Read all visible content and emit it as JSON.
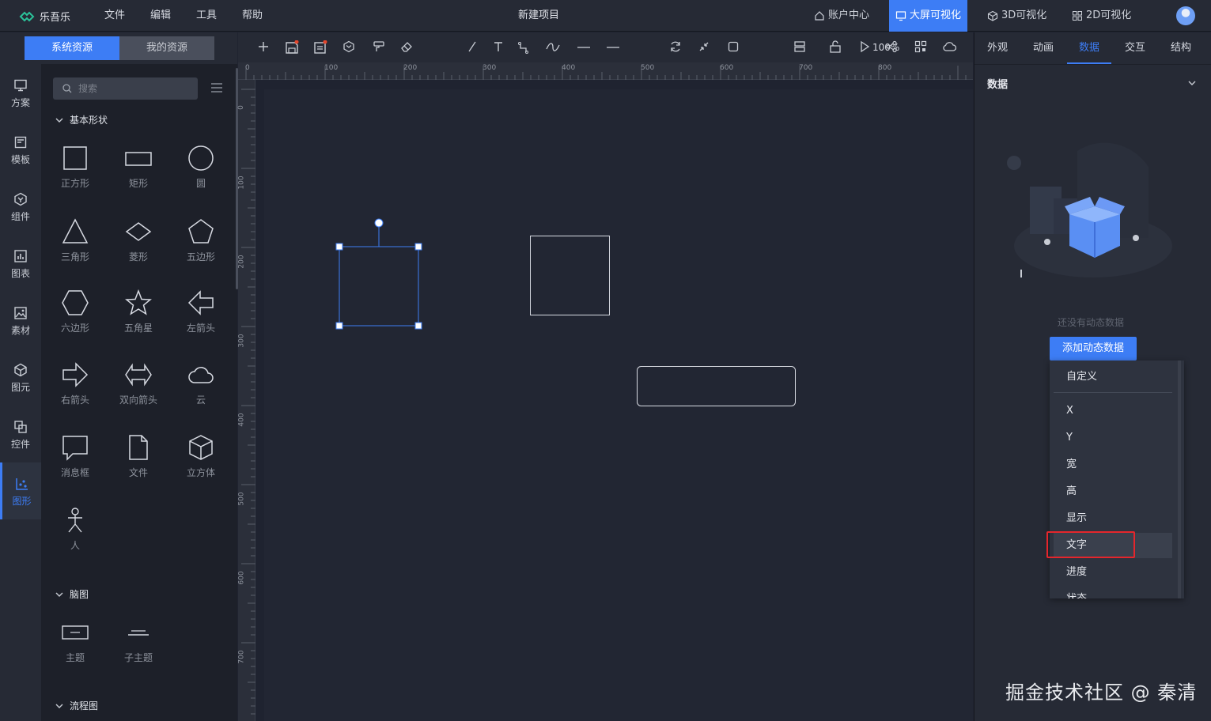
{
  "app": {
    "name": "乐吾乐",
    "project_title": "新建项目"
  },
  "menu": [
    "文件",
    "编辑",
    "工具",
    "帮助"
  ],
  "nav": {
    "account": "账户中心",
    "bigscreen": "大屏可视化",
    "viz3d": "3D可视化",
    "viz2d": "2D可视化"
  },
  "resource_tabs": {
    "system": "系统资源",
    "mine": "我的资源"
  },
  "side_nav": [
    "方案",
    "模板",
    "组件",
    "图表",
    "素材",
    "图元",
    "控件",
    "图形"
  ],
  "search": {
    "placeholder": "搜索"
  },
  "sections": {
    "basic": "基本形状",
    "mind": "脑图",
    "flow": "流程图"
  },
  "shapes": [
    "正方形",
    "矩形",
    "圆",
    "三角形",
    "菱形",
    "五边形",
    "六边形",
    "五角星",
    "左箭头",
    "右箭头",
    "双向箭头",
    "云",
    "消息框",
    "文件",
    "立方体",
    "人"
  ],
  "mind_shapes": [
    "主题",
    "子主题"
  ],
  "toolbar": {
    "zoom": "100%"
  },
  "ruler": {
    "h": [
      "0",
      "100",
      "200",
      "300",
      "400",
      "500",
      "600",
      "700",
      "800"
    ],
    "v": [
      "0",
      "100",
      "200",
      "300",
      "400",
      "500",
      "600",
      "700"
    ]
  },
  "right_tabs": [
    "外观",
    "动画",
    "数据",
    "交互",
    "结构"
  ],
  "data_panel": {
    "title": "数据",
    "empty_text": "还没有动态数据",
    "add_button": "添加动态数据",
    "dropdown": [
      "自定义",
      "X",
      "Y",
      "宽",
      "高",
      "显示",
      "文字",
      "进度",
      "状态"
    ]
  },
  "watermark": "掘金技术社区 @ 秦清",
  "colors": {
    "accent": "#3d7df5",
    "highlight_box": "#e5262c"
  }
}
